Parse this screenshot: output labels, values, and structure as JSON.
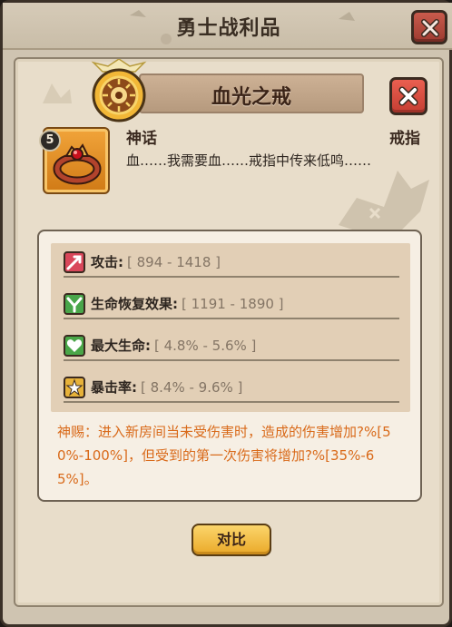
{
  "window": {
    "title": "勇士战利品"
  },
  "item": {
    "name": "血光之戒",
    "level": "5",
    "rarity": "神话",
    "type": "戒指",
    "flavor": "血……我需要血……戒指中传来低鸣……",
    "icon": "ring-icon"
  },
  "stats": [
    {
      "label": "攻击:",
      "range": "[ 894 - 1418 ]",
      "icon": "attack-icon",
      "color": "#d9475a"
    },
    {
      "label": "生命恢复效果:",
      "range": "[ 1191 - 1890 ]",
      "icon": "regen-icon",
      "color": "#49a64a"
    },
    {
      "label": "最大生命:",
      "range": "[ 4.8% - 5.6% ]",
      "icon": "heart-icon",
      "color": "#4aa648"
    },
    {
      "label": "暴击率:",
      "range": "[ 8.4% - 9.6% ]",
      "icon": "crit-icon",
      "color": "#e7b23a"
    }
  ],
  "mythic_bonus": "神赐：进入新房间当未受伤害时，造成的伤害增加?%[50%-100%]，但受到的第一次伤害将增加?%[35%-65%]。",
  "buttons": {
    "compare": "对比"
  },
  "colors": {
    "mythic_text": "#d96a1a",
    "compare_button": "#f4c24a",
    "close_button": "#d64d40"
  }
}
